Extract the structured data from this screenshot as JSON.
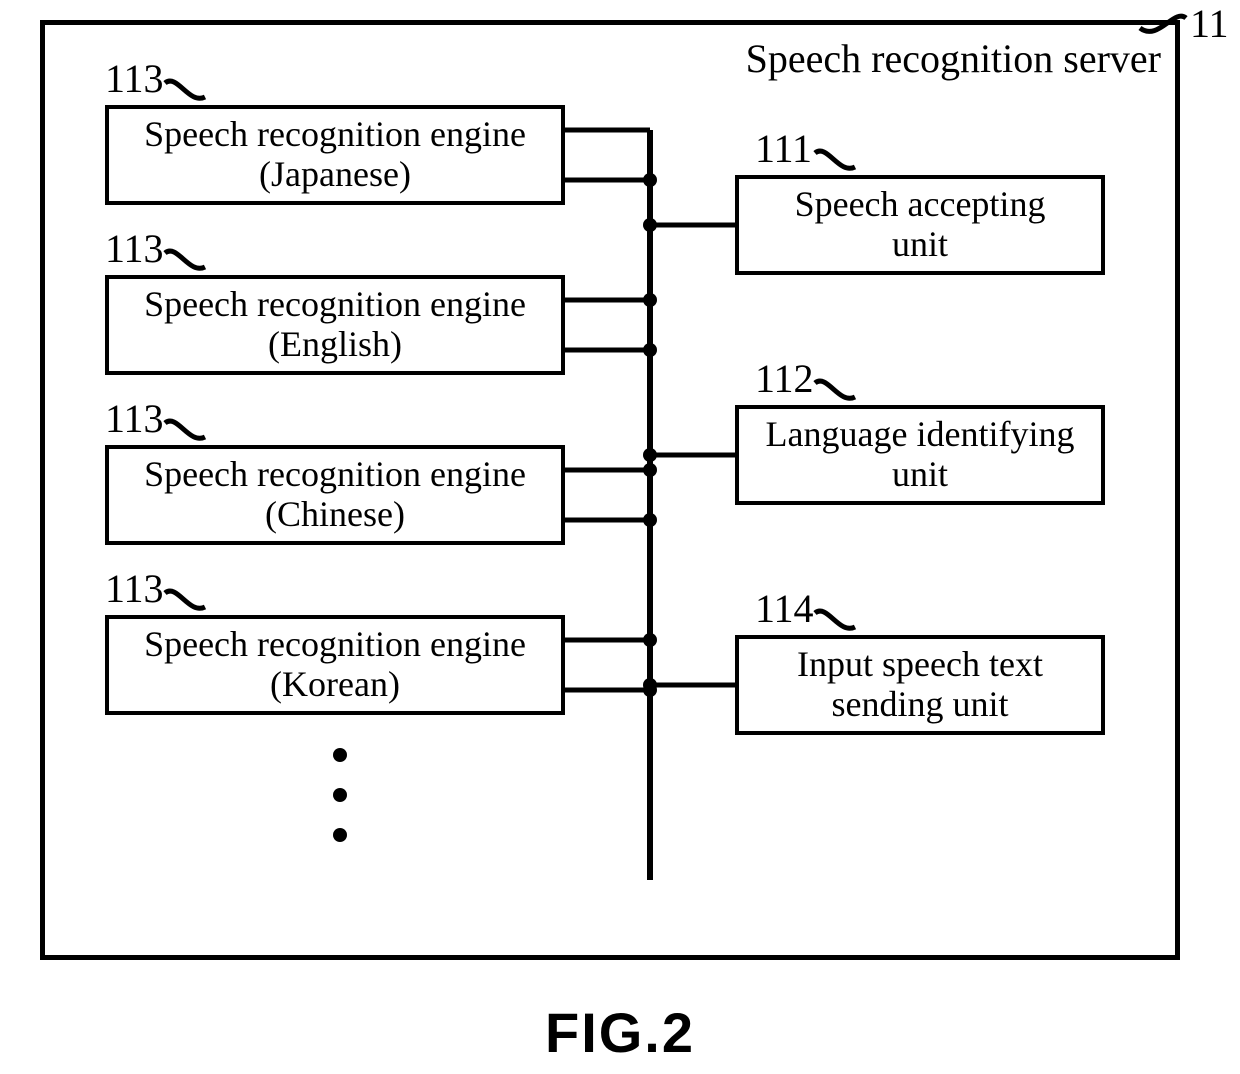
{
  "figure_caption": "FIG.2",
  "outer": {
    "ref": "11",
    "title": "Speech recognition server"
  },
  "engines": [
    {
      "ref": "113",
      "line1": "Speech recognition engine",
      "line2": "(Japanese)"
    },
    {
      "ref": "113",
      "line1": "Speech recognition engine",
      "line2": "(English)"
    },
    {
      "ref": "113",
      "line1": "Speech recognition engine",
      "line2": "(Chinese)"
    },
    {
      "ref": "113",
      "line1": "Speech recognition engine",
      "line2": "(Korean)"
    }
  ],
  "right_units": [
    {
      "ref": "111",
      "line1": "Speech accepting",
      "line2": "unit"
    },
    {
      "ref": "112",
      "line1": "Language identifying",
      "line2": "unit"
    },
    {
      "ref": "114",
      "line1": "Input speech text",
      "line2": "sending unit"
    }
  ]
}
